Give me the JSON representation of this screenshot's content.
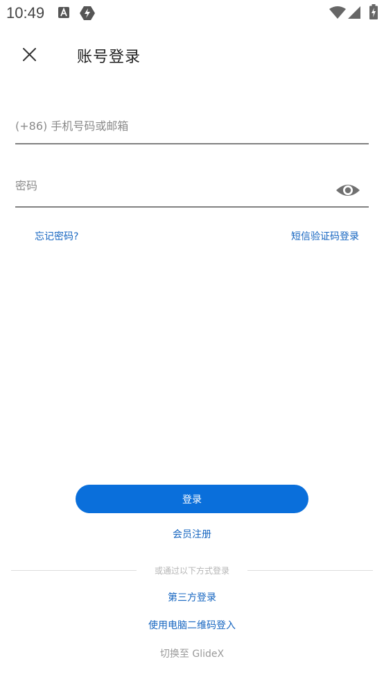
{
  "status_bar": {
    "time": "10:49",
    "icons": [
      "notification-a-icon",
      "app-notification-icon",
      "wifi-icon",
      "cell-signal-icon",
      "battery-icon"
    ]
  },
  "header": {
    "title": "账号登录",
    "close_icon": "close-icon"
  },
  "form": {
    "phone_placeholder": "(+86) 手机号码或邮箱",
    "password_placeholder": "密码",
    "eye_icon": "eye-icon"
  },
  "links": {
    "forgot_password": "忘记密码?",
    "sms_login": "短信验证码登录"
  },
  "actions": {
    "login": "登录",
    "register": "会员注册",
    "divider": "或通过以下方式登录",
    "third_party": "第三方登录",
    "qr_login": "使用电脑二维码登入",
    "switch": "切换至 GlideX"
  },
  "colors": {
    "accent": "#0a6fdb",
    "link": "#1565c0",
    "underline": "#808080"
  }
}
